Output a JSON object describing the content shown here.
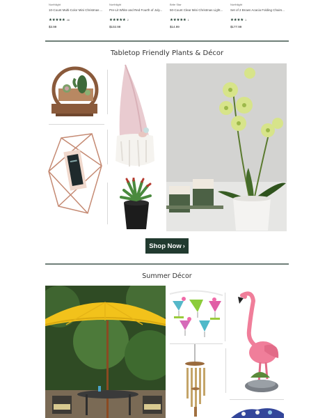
{
  "products": [
    {
      "brand": "Northlight",
      "name": "10-Count Multi-Color Mini Christmas ...",
      "rating": 4.5,
      "stars": "★★★★★",
      "count": "46",
      "price": "$3.99"
    },
    {
      "brand": "Northlight",
      "name": "Pre-Lit White and Red Fourth of July...",
      "rating": 4.5,
      "stars": "★★★★★",
      "count": "2",
      "price": "$102.99"
    },
    {
      "brand": "Brite Star",
      "name": "50-Count Clear Mini Christmas Light...",
      "rating": 5,
      "stars": "★★★★★",
      "count": "1",
      "price": "$14.99"
    },
    {
      "brand": "Northlight",
      "name": "Set of 2 Brown Acacia Folding Chairs...",
      "rating": 4,
      "stars": "★★★★",
      "count": "1",
      "price": "$177.99"
    }
  ],
  "tabletop": {
    "title": "Tabletop Friendly Plants & Décor",
    "button_label": "Shop Now",
    "button_chevron": "›"
  },
  "summer": {
    "title": "Summer Décor"
  },
  "colors": {
    "brand_dark": "#213a2f",
    "star": "#243f33",
    "rule": "#6f7f78",
    "umbrella": "#f2c21b",
    "flamingo": "#f07e9a"
  }
}
